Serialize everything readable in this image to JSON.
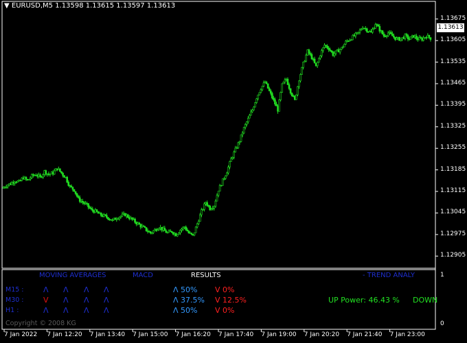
{
  "chart_header": {
    "symbol": "EURUSD,M5",
    "open": "1.13598",
    "high": "1.13615",
    "low": "1.13597",
    "close": "1.13613"
  },
  "current_price": "1.13613",
  "price_axis": [
    "1.13675",
    "1.13605",
    "1.13535",
    "1.13465",
    "1.13395",
    "1.13325",
    "1.13255",
    "1.13185",
    "1.13115",
    "1.13045",
    "1.12975",
    "1.12905"
  ],
  "time_axis": [
    "7 Jan 2022",
    "7 Jan 12:20",
    "7 Jan 13:40",
    "7 Jan 15:00",
    "7 Jan 16:20",
    "7 Jan 17:40",
    "7 Jan 19:00",
    "7 Jan 20:20",
    "7 Jan 21:40",
    "7 Jan 23:00"
  ],
  "indicator": {
    "col_ma": "MOVING AVERAGES",
    "col_macd": "MACD",
    "col_results": "RESULTS",
    "col_trend": "- TREND ANALY",
    "rows": [
      {
        "tf": "M15 :",
        "arrows": [
          "Λ",
          "Λ",
          "Λ",
          "Λ"
        ],
        "arrow_colors": [
          "#1e2fd0",
          "#1e2fd0",
          "#1e2fd0",
          "#1e2fd0"
        ],
        "up": "Λ 50%",
        "down": "V 0%"
      },
      {
        "tf": "M30 :",
        "arrows": [
          "V",
          "Λ",
          "Λ",
          "Λ"
        ],
        "arrow_colors": [
          "#e01010",
          "#1e2fd0",
          "#1e2fd0",
          "#1e2fd0"
        ],
        "up": "Λ 37.5%",
        "down": "V 12.5%"
      },
      {
        "tf": "H1  :",
        "arrows": [
          "Λ",
          "Λ",
          "Λ",
          "Λ"
        ],
        "arrow_colors": [
          "#1e2fd0",
          "#1e2fd0",
          "#1e2fd0",
          "#1e2fd0"
        ],
        "up": "Λ 50%",
        "down": "V 0%"
      }
    ],
    "copyright": "Copyright © 2008 KG",
    "up_power": "UP Power: 46.43 %",
    "down_power": "DOWN"
  },
  "sub_axis": {
    "top": "1",
    "bottom": "0"
  },
  "colors": {
    "bull": "#22e022",
    "bear": "#22e022",
    "up_text": "#3399ff",
    "down_text": "#ff2020"
  },
  "chart_data": {
    "type": "candlestick",
    "symbol": "EURUSD,M5",
    "ylim": [
      1.1287,
      1.1371
    ],
    "closes": [
      1.13125,
      1.13135,
      1.1314,
      1.1315,
      1.13145,
      1.1316,
      1.1315,
      1.13165,
      1.1317,
      1.1316,
      1.1318,
      1.1317,
      1.13175,
      1.1319,
      1.13175,
      1.1316,
      1.1313,
      1.1312,
      1.1309,
      1.1308,
      1.1307,
      1.13055,
      1.1305,
      1.1304,
      1.13035,
      1.1303,
      1.1302,
      1.1303,
      1.13035,
      1.1304,
      1.1303,
      1.1302,
      1.1301,
      1.13,
      1.1299,
      1.1298,
      1.1299,
      1.13,
      1.1299,
      1.1298,
      1.12985,
      1.12975,
      1.1299,
      1.13,
      1.1298,
      1.1297,
      1.1301,
      1.1305,
      1.1308,
      1.1306,
      1.1307,
      1.1312,
      1.1315,
      1.1318,
      1.1322,
      1.1325,
      1.1328,
      1.1332,
      1.1335,
      1.1338,
      1.1342,
      1.1345,
      1.1347,
      1.1344,
      1.1341,
      1.1338,
      1.1346,
      1.1348,
      1.1344,
      1.1341,
      1.1348,
      1.1353,
      1.1357,
      1.1355,
      1.1352,
      1.1356,
      1.1359,
      1.1358,
      1.1356,
      1.1357,
      1.1358,
      1.136,
      1.1361,
      1.1362,
      1.1363,
      1.1365,
      1.1364,
      1.1363,
      1.1366,
      1.1364,
      1.1362,
      1.1363,
      1.1362,
      1.1361,
      1.1361,
      1.1362,
      1.1361,
      1.1362,
      1.1361,
      1.1361,
      1.1362,
      1.13613
    ],
    "price_axis_labels": [
      "1.13675",
      "1.13605",
      "1.13535",
      "1.13465",
      "1.13395",
      "1.13325",
      "1.13255",
      "1.13185",
      "1.13115",
      "1.13045",
      "1.12975",
      "1.12905"
    ],
    "time_labels": [
      "7 Jan 2022",
      "7 Jan 12:20",
      "7 Jan 13:40",
      "7 Jan 15:00",
      "7 Jan 16:20",
      "7 Jan 17:40",
      "7 Jan 19:00",
      "7 Jan 20:20",
      "7 Jan 21:40",
      "7 Jan 23:00"
    ]
  }
}
